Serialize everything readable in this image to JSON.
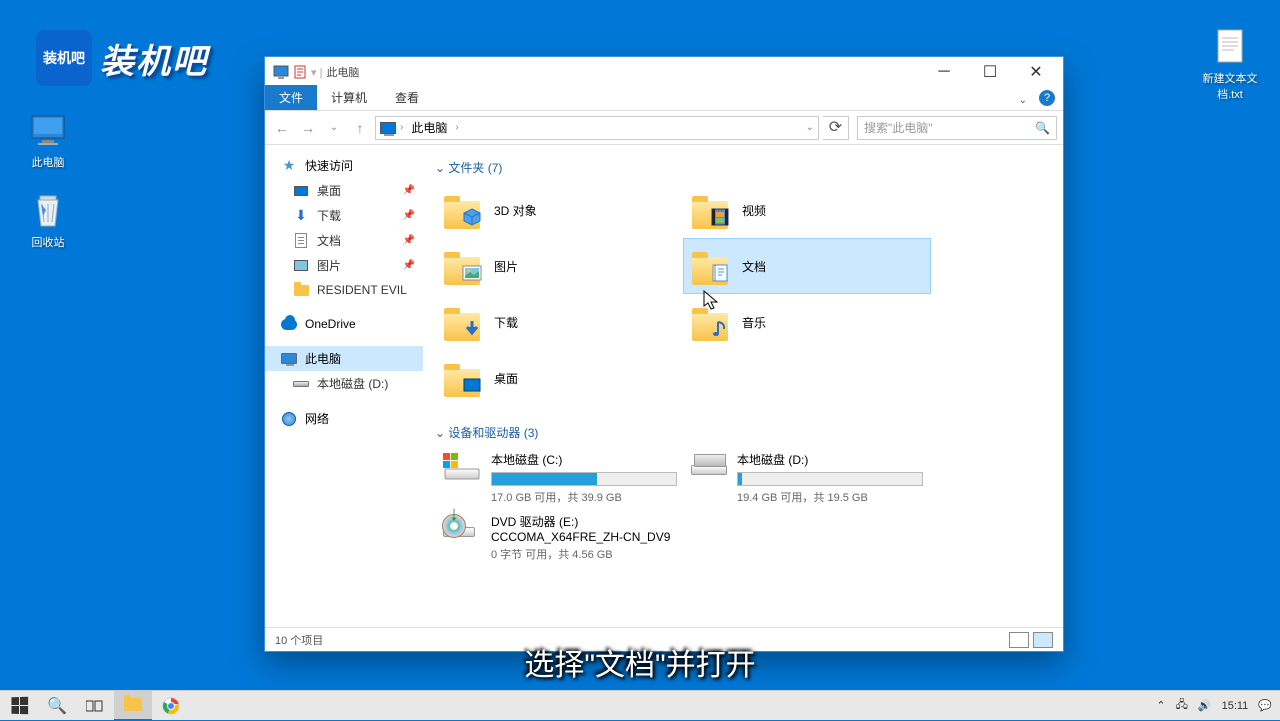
{
  "logo_text": "装机吧",
  "desktop": {
    "this_pc": "此电脑",
    "recycle_bin": "回收站",
    "txt": "新建文本文档.txt"
  },
  "window": {
    "title": "此电脑",
    "tabs": {
      "file": "文件",
      "computer": "计算机",
      "view": "查看"
    },
    "breadcrumb": "此电脑",
    "search_placeholder": "搜索\"此电脑\"",
    "sidebar": {
      "quick": "快速访问",
      "desktop": "桌面",
      "downloads": "下载",
      "documents": "文档",
      "pictures": "图片",
      "resident": "RESIDENT EVIL",
      "onedrive": "OneDrive",
      "thispc": "此电脑",
      "dlocal": "本地磁盘 (D:)",
      "network": "网络"
    },
    "group_folders": "文件夹 (7)",
    "folders": {
      "objects3d": "3D 对象",
      "videos": "视频",
      "pictures": "图片",
      "documents": "文档",
      "downloads": "下载",
      "music": "音乐",
      "desktop": "桌面"
    },
    "group_drives": "设备和驱动器 (3)",
    "drives": {
      "c": {
        "label": "本地磁盘 (C:)",
        "free": "17.0 GB 可用，共 39.9 GB",
        "fill_pct": 57
      },
      "d": {
        "label": "本地磁盘 (D:)",
        "free": "19.4 GB 可用，共 19.5 GB",
        "fill_pct": 2
      },
      "e": {
        "label1": "DVD 驱动器 (E:)",
        "label2": "CCCOMA_X64FRE_ZH-CN_DV9",
        "free": "0 字节 可用，共 4.56 GB"
      }
    },
    "status": "10 个项目"
  },
  "subtitle": "选择\"文档\"并打开",
  "taskbar": {
    "time": "15:11"
  }
}
